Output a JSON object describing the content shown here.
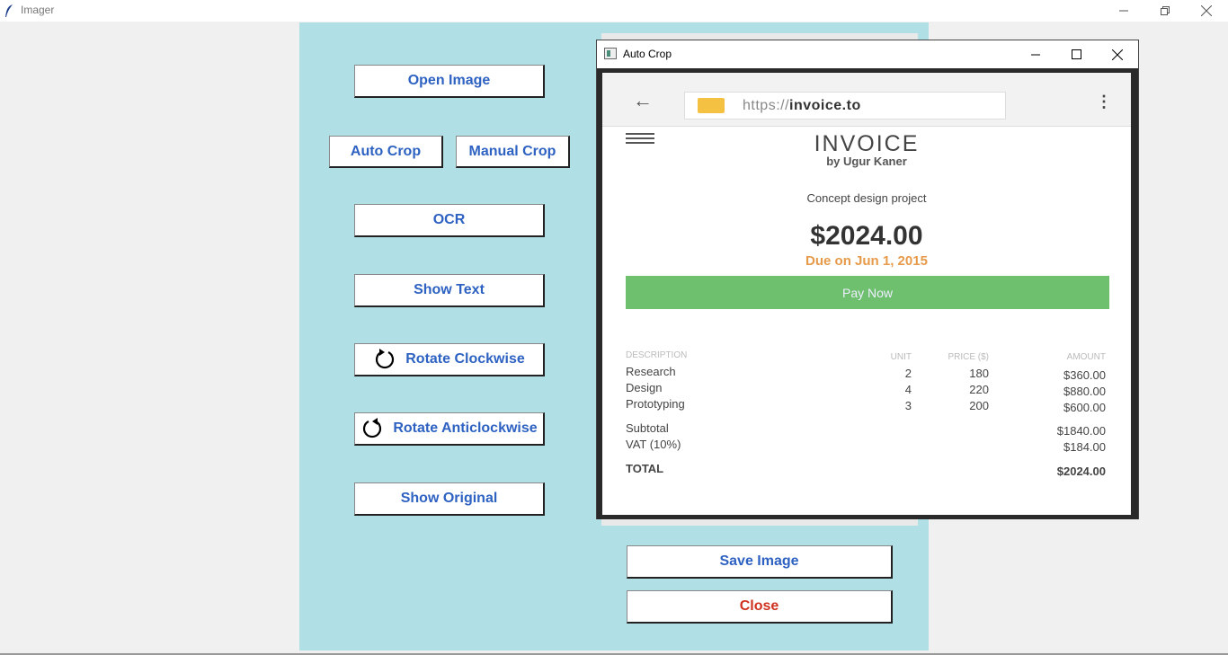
{
  "window": {
    "title": "Imager"
  },
  "buttons": {
    "open_image": "Open Image",
    "auto_crop": "Auto Crop",
    "manual_crop": "Manual Crop",
    "ocr": "OCR",
    "show_text": "Show Text",
    "rotate_clockwise": "Rotate Clockwise",
    "rotate_anticlockwise": "Rotate Anticlockwise",
    "show_original": "Show Original",
    "save_image": "Save Image",
    "close": "Close"
  },
  "colors": {
    "panel": "#b0dfe5",
    "button_text": "#2e62c2",
    "close_text": "#d0311f"
  },
  "crop_window": {
    "title": "Auto Crop",
    "image": {
      "url_prefix": "https://",
      "url_host": "invoice.to",
      "title": "INVOICE",
      "author": "by Ugur Kaner",
      "project": "Concept design project",
      "amount": "$2024.00",
      "due": "Due on Jun 1, 2015",
      "pay_button": "Pay Now",
      "headers": {
        "description": "DESCRIPTION",
        "unit": "UNIT",
        "price": "PRICE ($)",
        "amount": "AMOUNT"
      },
      "rows": [
        {
          "description": "Research",
          "unit": "2",
          "price": "180",
          "amount": "$360.00"
        },
        {
          "description": "Design",
          "unit": "4",
          "price": "220",
          "amount": "$880.00"
        },
        {
          "description": "Prototyping",
          "unit": "3",
          "price": "200",
          "amount": "$600.00"
        }
      ],
      "subtotal_label": "Subtotal",
      "subtotal": "$1840.00",
      "vat_label": "VAT (10%)",
      "vat": "$184.00",
      "total_label": "TOTAL",
      "total": "$2024.00"
    }
  }
}
